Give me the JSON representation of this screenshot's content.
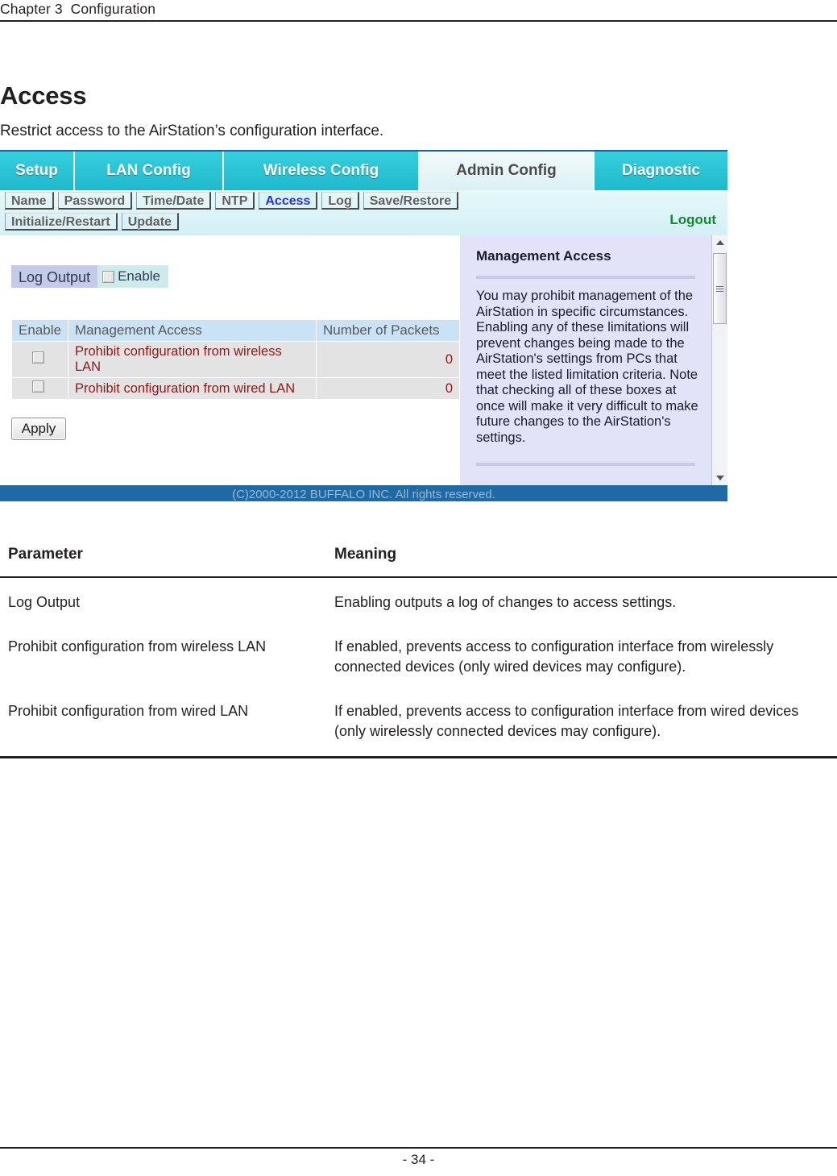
{
  "page": {
    "running_header": "Chapter 3  Configuration",
    "page_number": "- 34 -",
    "section_title": "Access",
    "section_intro": "Restrict access to the AirStation’s configuration interface."
  },
  "screenshot": {
    "main_tabs": [
      {
        "label": "Setup",
        "active": false
      },
      {
        "label": "LAN Config",
        "active": false
      },
      {
        "label": "Wireless Config",
        "active": false
      },
      {
        "label": "Admin Config",
        "active": true
      },
      {
        "label": "Diagnostic",
        "active": false
      }
    ],
    "sub_tabs_row1": [
      {
        "label": "Name",
        "active": false
      },
      {
        "label": "Password",
        "active": false
      },
      {
        "label": "Time/Date",
        "active": false
      },
      {
        "label": "NTP",
        "active": false
      },
      {
        "label": "Access",
        "active": true
      },
      {
        "label": "Log",
        "active": false
      },
      {
        "label": "Save/Restore",
        "active": false
      }
    ],
    "sub_tabs_row2": [
      {
        "label": "Initialize/Restart",
        "active": false
      },
      {
        "label": "Update",
        "active": false
      }
    ],
    "logout_label": "Logout",
    "log_output": {
      "label": "Log Output",
      "enable_label": "Enable",
      "checked": false
    },
    "access_table": {
      "headers": [
        "Enable",
        "Management Access",
        "Number of Packets"
      ],
      "rows": [
        {
          "enabled": false,
          "name": "Prohibit configuration from wireless LAN",
          "packets": "0"
        },
        {
          "enabled": false,
          "name": "Prohibit configuration from wired LAN",
          "packets": "0"
        }
      ]
    },
    "apply_label": "Apply",
    "help": {
      "title": "Management Access",
      "body": "You may prohibit management of the AirStation in specific circumstances. Enabling any of these limitations will prevent changes being made to the AirStation's settings from PCs that meet the listed limitation criteria. Note that checking all of these boxes at once will make it very difficult to make future changes to the AirStation's settings."
    },
    "footer": "(C)2000-2012 BUFFALO INC. All rights reserved.",
    "colors": {
      "tab_teal": "#29c5d6",
      "active_tab_text": "#4a4a4a",
      "subtab_active_text": "#2a2aee",
      "logout_green": "#0a8a2a",
      "table_header_blue": "#c9e2f5",
      "table_row_gray": "#e3e3e3",
      "row_text_red": "#8b1a1a",
      "help_panel_lavender": "#e2e2f9",
      "footer_blue": "#1f6aa5"
    }
  },
  "param_table": {
    "headers": {
      "parameter": "Parameter",
      "meaning": "Meaning"
    },
    "rows": [
      {
        "parameter": "Log Output",
        "meaning": "Enabling outputs a log of changes to access settings."
      },
      {
        "parameter": "Prohibit configuration from wireless LAN",
        "meaning": "If enabled, prevents access to configuration interface from wirelessly connected devices (only wired devices may configure)."
      },
      {
        "parameter": "Prohibit configuration from wired LAN",
        "meaning": "If enabled, prevents access to configuration interface from wired devices (only wirelessly connected devices may configure)."
      }
    ]
  }
}
